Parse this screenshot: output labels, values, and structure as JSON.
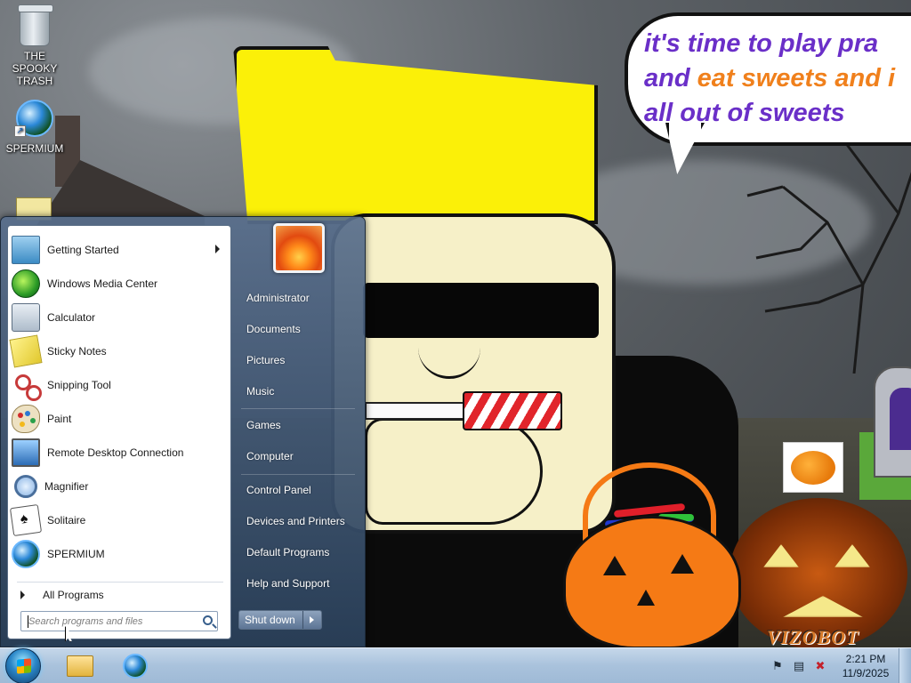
{
  "desktop": {
    "icons": [
      {
        "label": "THE SPOOKY TRASH",
        "icon": "recycle-bin-icon"
      },
      {
        "label": "SPERMIUM",
        "icon": "globe-browser-icon"
      }
    ],
    "speech_bubble": {
      "line1": "it's time to play pra",
      "line2a": "and ",
      "line2b": "eat sweets and i",
      "line3": "all out of sweets"
    },
    "watermark": "VIZOBOT"
  },
  "start_menu": {
    "programs": [
      {
        "label": "Getting Started",
        "icon": "getting-started-icon",
        "has_submenu": true
      },
      {
        "label": "Windows Media Center",
        "icon": "windows-media-center-icon"
      },
      {
        "label": "Calculator",
        "icon": "calculator-icon"
      },
      {
        "label": "Sticky Notes",
        "icon": "sticky-notes-icon"
      },
      {
        "label": "Snipping Tool",
        "icon": "scissors-icon"
      },
      {
        "label": "Paint",
        "icon": "paint-palette-icon"
      },
      {
        "label": "Remote Desktop Connection",
        "icon": "remote-desktop-icon"
      },
      {
        "label": "Magnifier",
        "icon": "magnifier-icon"
      },
      {
        "label": "Solitaire",
        "icon": "playing-card-icon"
      },
      {
        "label": "SPERMIUM",
        "icon": "globe-browser-icon"
      }
    ],
    "all_programs": "All Programs",
    "search_placeholder": "Search programs and files",
    "right": {
      "user": "Administrator",
      "documents": "Documents",
      "pictures": "Pictures",
      "music": "Music",
      "games": "Games",
      "computer": "Computer",
      "control_panel": "Control Panel",
      "devices": "Devices and Printers",
      "default_programs": "Default Programs",
      "help": "Help and Support"
    },
    "shutdown_label": "Shut down"
  },
  "taskbar": {
    "pinned": [
      "explorer-folder-icon",
      "globe-browser-icon"
    ],
    "tray": [
      "action-center-flag-icon",
      "network-icon",
      "volume-muted-icon"
    ],
    "time": "2:21 PM",
    "date": "11/9/2025"
  }
}
